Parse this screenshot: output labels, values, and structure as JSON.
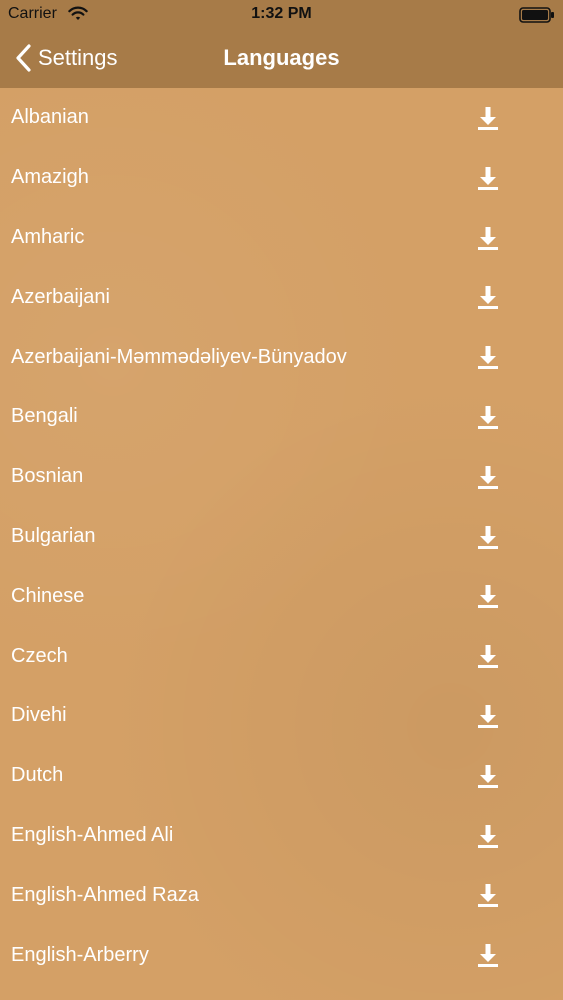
{
  "status_bar": {
    "carrier": "Carrier",
    "time": "1:32 PM",
    "wifi_icon": "wifi-icon",
    "battery_icon": "battery-icon"
  },
  "nav": {
    "back_label": "Settings",
    "title": "Languages",
    "back_icon": "chevron-left-icon"
  },
  "colors": {
    "bar_background": "#a77b48",
    "list_background": "#d4a066",
    "text": "#ffffff"
  },
  "languages": [
    {
      "label": "Albanian",
      "action_icon": "download-icon"
    },
    {
      "label": "Amazigh",
      "action_icon": "download-icon"
    },
    {
      "label": "Amharic",
      "action_icon": "download-icon"
    },
    {
      "label": "Azerbaijani",
      "action_icon": "download-icon"
    },
    {
      "label": "Azerbaijani-Məmmədəliyev-Bünyadov",
      "action_icon": "download-icon"
    },
    {
      "label": "Bengali",
      "action_icon": "download-icon"
    },
    {
      "label": "Bosnian",
      "action_icon": "download-icon"
    },
    {
      "label": "Bulgarian",
      "action_icon": "download-icon"
    },
    {
      "label": "Chinese",
      "action_icon": "download-icon"
    },
    {
      "label": "Czech",
      "action_icon": "download-icon"
    },
    {
      "label": "Divehi",
      "action_icon": "download-icon"
    },
    {
      "label": "Dutch",
      "action_icon": "download-icon"
    },
    {
      "label": "English-Ahmed Ali",
      "action_icon": "download-icon"
    },
    {
      "label": "English-Ahmed Raza",
      "action_icon": "download-icon"
    },
    {
      "label": "English-Arberry",
      "action_icon": "download-icon"
    }
  ]
}
